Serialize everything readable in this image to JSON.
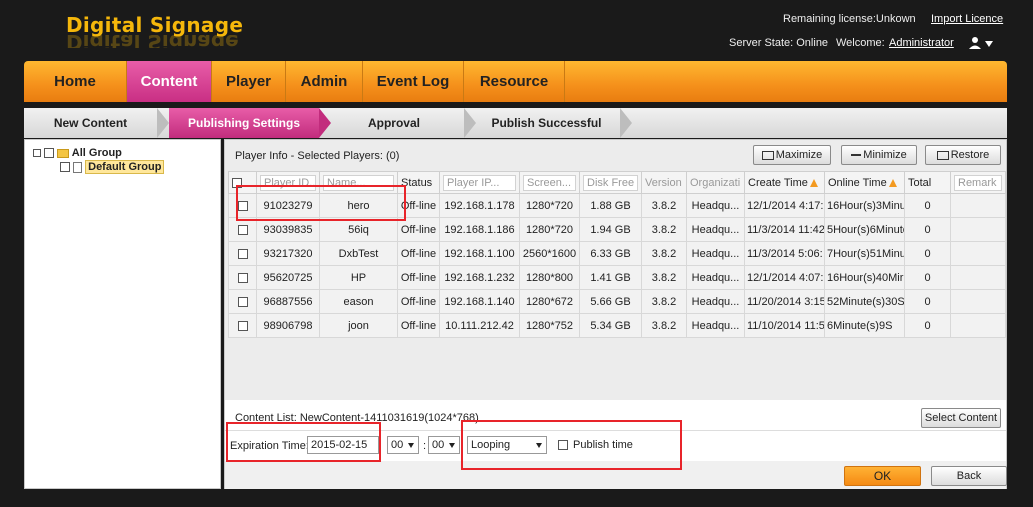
{
  "header": {
    "app_title": "Digital Signage",
    "license_text": "Remaining license:Unkown",
    "import_licence": "Import Licence",
    "server_state": "Server State: Online",
    "welcome": "Welcome:",
    "user": "Administrator"
  },
  "nav": {
    "items": [
      "Home",
      "Content",
      "Player",
      "Admin",
      "Event Log",
      "Resource"
    ],
    "active": "Content"
  },
  "steps": {
    "items": [
      "New Content",
      "Publishing Settings",
      "Approval",
      "Publish Successful"
    ],
    "active": "Publishing Settings"
  },
  "tree": {
    "root": "All Group",
    "child": "Default Group"
  },
  "player_info": {
    "title": "Player Info - Selected Players: (0)",
    "maximize": "Maximize",
    "minimize": "Minimize",
    "restore": "Restore"
  },
  "table": {
    "headers": [
      "",
      "Player ID...",
      "Name...",
      "Status",
      "Player IP...",
      "Screen...",
      "Disk Free",
      "Version",
      "Organizati",
      "Create Time",
      "Online Time",
      "Total",
      "Remark"
    ],
    "rows": [
      [
        "91023279",
        "hero",
        "Off-line",
        "192.168.1.178",
        "1280*720",
        "1.88 GB",
        "3.8.2",
        "Headqu...",
        "12/1/2014 4:17:",
        "16Hour(s)3Minu",
        "0"
      ],
      [
        "93039835",
        "56iq",
        "Off-line",
        "192.168.1.186",
        "1280*720",
        "1.94 GB",
        "3.8.2",
        "Headqu...",
        "11/3/2014 11:42",
        "5Hour(s)6Minute",
        "0"
      ],
      [
        "93217320",
        "DxbTest",
        "Off-line",
        "192.168.1.100",
        "2560*1600",
        "6.33 GB",
        "3.8.2",
        "Headqu...",
        "11/3/2014 5:06:",
        "7Hour(s)51Minu",
        "0"
      ],
      [
        "95620725",
        "HP",
        "Off-line",
        "192.168.1.232",
        "1280*800",
        "1.41 GB",
        "3.8.2",
        "Headqu...",
        "12/1/2014 4:07:",
        "16Hour(s)40Mir",
        "0"
      ],
      [
        "96887556",
        "eason",
        "Off-line",
        "192.168.1.140",
        "1280*672",
        "5.66 GB",
        "3.8.2",
        "Headqu...",
        "11/20/2014 3:15",
        "52Minute(s)30S",
        "0"
      ],
      [
        "98906798",
        "joon",
        "Off-line",
        "10.111.212.42",
        "1280*752",
        "5.34 GB",
        "3.8.2",
        "Headqu...",
        "11/10/2014 11:5",
        "6Minute(s)9S",
        "0"
      ]
    ]
  },
  "content": {
    "list_label": "Content List: NewContent-1411031619(1024*768)",
    "select_content": "Select Content",
    "expiration_label": "Expiration Time:",
    "expiration_date": "2015-02-15",
    "hour": "00",
    "minute": "00",
    "colon": ":",
    "mode": "Looping",
    "publish_time": "Publish time",
    "ok": "OK",
    "back": "Back"
  },
  "colors": {
    "nav_orange": "#f5901b",
    "active_pink": "#c92f84",
    "logo_gold": "#f5b70b",
    "annotation_red": "#e8242a"
  }
}
